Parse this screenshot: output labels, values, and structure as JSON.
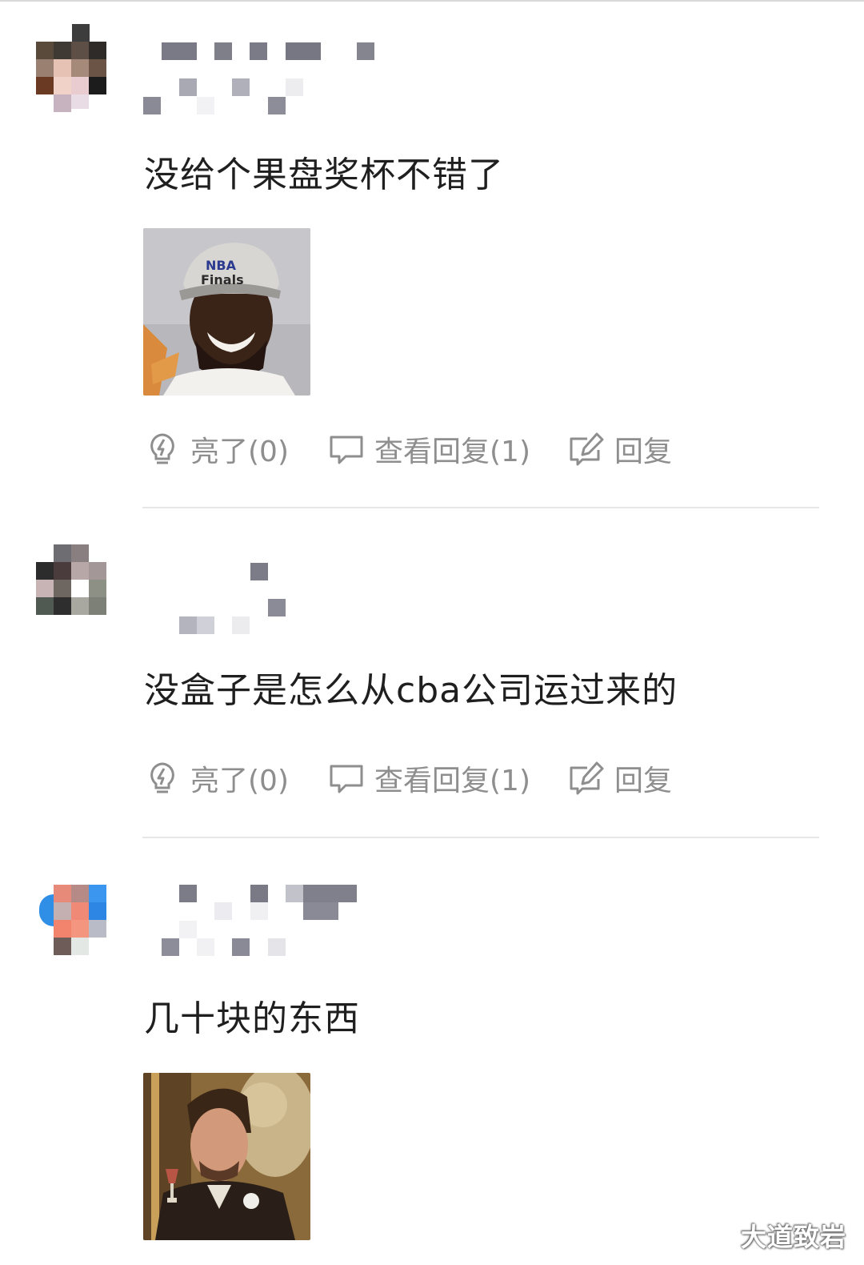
{
  "comments": [
    {
      "text": "没给个果盘奖杯不错了",
      "image": "smiling man wearing NBA Finals cap",
      "actions": {
        "like": "亮了(0)",
        "view_replies": "查看回复(1)",
        "reply": "回复"
      }
    },
    {
      "text": "没盒子是怎么从cba公司运过来的",
      "actions": {
        "like": "亮了(0)",
        "view_replies": "查看回复(1)",
        "reply": "回复"
      }
    },
    {
      "text": "几十块的东西",
      "image": "man in period costume raising a glass and laughing"
    }
  ],
  "icons": {
    "like": "lightbulb-icon",
    "view_replies": "speech-bubble-icon",
    "reply": "pencil-edit-icon"
  },
  "watermark": "大道致岩",
  "colors": {
    "text": "#1f1f1f",
    "muted": "#8e8e8e",
    "divider": "#e6e6e6",
    "mosaic_gray": "#7a7a86"
  }
}
